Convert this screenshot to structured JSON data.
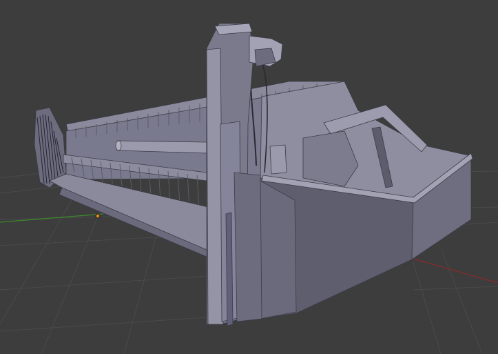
{
  "viewport": {
    "background_color": "#3d3d3d",
    "grid_line_color": "#4a4a4a",
    "x_axis_color": "#8a2a2a",
    "y_axis_color": "#3c8a2a"
  },
  "model": {
    "icon": "combine-header-mesh-icon",
    "face_light": "#9a9aac",
    "face_mid": "#7f7f92",
    "face_dark": "#5c5c6c",
    "face_darker": "#48485a",
    "edge_color": "#3a3a46"
  },
  "origin_point": {
    "icon": "object-origin-icon",
    "color": "#d08a2a"
  }
}
